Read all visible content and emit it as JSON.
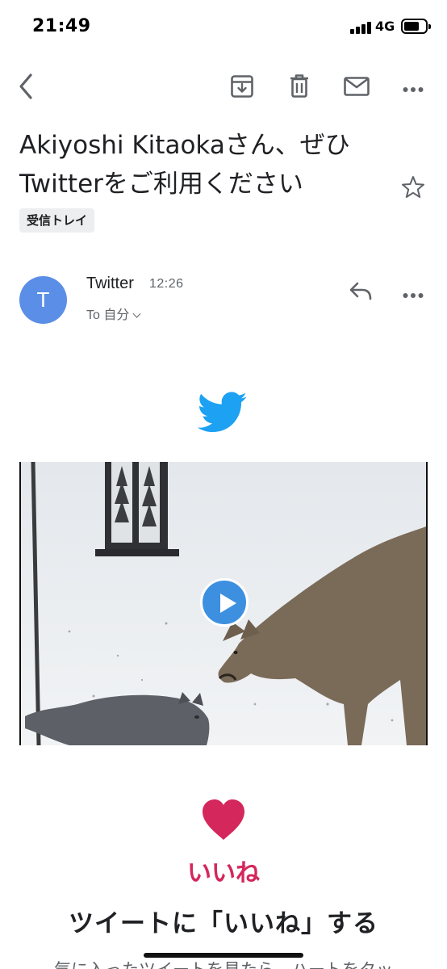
{
  "status_bar": {
    "time": "21:49",
    "network": "4G",
    "battery_level": 0.72
  },
  "toolbar": {
    "back_icon": "arrow-left-icon",
    "archive_icon": "archive-icon",
    "delete_icon": "trash-icon",
    "mark_unread_icon": "envelope-icon",
    "more_icon": "more-horizontal-icon"
  },
  "email": {
    "subject_line1": "Akiyoshi Kitaokaさん、ぜひ",
    "subject_line2": "Twitterをご利用ください",
    "label": "受信トレイ",
    "star_icon": "star-outline-icon"
  },
  "sender": {
    "avatar_letter": "T",
    "avatar_color": "#5b8ee6",
    "name": "Twitter",
    "time": "12:26",
    "recipient": "To 自分",
    "reply_icon": "reply-icon",
    "more_icon": "more-horizontal-icon"
  },
  "content": {
    "logo_icon": "twitter-bird-icon",
    "video_play_icon": "play-icon",
    "like_icon": "heart-icon",
    "like_label": "いいね",
    "heading": "ツイートに「いいね」する",
    "description": "気に入ったツイートを見たら、ハートをタッ"
  },
  "colors": {
    "twitter_blue": "#1da1f2",
    "like_red": "#d4275c",
    "play_blue": "#3d8fe0"
  }
}
